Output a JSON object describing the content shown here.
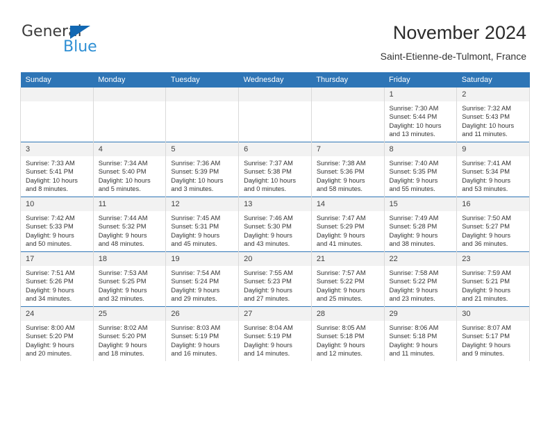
{
  "brand": {
    "line1": "General",
    "line2": "Blue",
    "accent_color": "#1268b3",
    "secondary_color": "#2e8fd4"
  },
  "header": {
    "title": "November 2024",
    "subtitle": "Saint-Etienne-de-Tulmont, France"
  },
  "theme": {
    "header_bg": "#2e75b6",
    "daynum_bg": "#f2f2f2",
    "cell_border": "#d9d9d9"
  },
  "weekday_headers": [
    "Sunday",
    "Monday",
    "Tuesday",
    "Wednesday",
    "Thursday",
    "Friday",
    "Saturday"
  ],
  "weeks": [
    [
      {
        "day": "",
        "lines": []
      },
      {
        "day": "",
        "lines": []
      },
      {
        "day": "",
        "lines": []
      },
      {
        "day": "",
        "lines": []
      },
      {
        "day": "",
        "lines": []
      },
      {
        "day": "1",
        "lines": [
          "Sunrise: 7:30 AM",
          "Sunset: 5:44 PM",
          "Daylight: 10 hours",
          "and 13 minutes."
        ]
      },
      {
        "day": "2",
        "lines": [
          "Sunrise: 7:32 AM",
          "Sunset: 5:43 PM",
          "Daylight: 10 hours",
          "and 11 minutes."
        ]
      }
    ],
    [
      {
        "day": "3",
        "lines": [
          "Sunrise: 7:33 AM",
          "Sunset: 5:41 PM",
          "Daylight: 10 hours",
          "and 8 minutes."
        ]
      },
      {
        "day": "4",
        "lines": [
          "Sunrise: 7:34 AM",
          "Sunset: 5:40 PM",
          "Daylight: 10 hours",
          "and 5 minutes."
        ]
      },
      {
        "day": "5",
        "lines": [
          "Sunrise: 7:36 AM",
          "Sunset: 5:39 PM",
          "Daylight: 10 hours",
          "and 3 minutes."
        ]
      },
      {
        "day": "6",
        "lines": [
          "Sunrise: 7:37 AM",
          "Sunset: 5:38 PM",
          "Daylight: 10 hours",
          "and 0 minutes."
        ]
      },
      {
        "day": "7",
        "lines": [
          "Sunrise: 7:38 AM",
          "Sunset: 5:36 PM",
          "Daylight: 9 hours",
          "and 58 minutes."
        ]
      },
      {
        "day": "8",
        "lines": [
          "Sunrise: 7:40 AM",
          "Sunset: 5:35 PM",
          "Daylight: 9 hours",
          "and 55 minutes."
        ]
      },
      {
        "day": "9",
        "lines": [
          "Sunrise: 7:41 AM",
          "Sunset: 5:34 PM",
          "Daylight: 9 hours",
          "and 53 minutes."
        ]
      }
    ],
    [
      {
        "day": "10",
        "lines": [
          "Sunrise: 7:42 AM",
          "Sunset: 5:33 PM",
          "Daylight: 9 hours",
          "and 50 minutes."
        ]
      },
      {
        "day": "11",
        "lines": [
          "Sunrise: 7:44 AM",
          "Sunset: 5:32 PM",
          "Daylight: 9 hours",
          "and 48 minutes."
        ]
      },
      {
        "day": "12",
        "lines": [
          "Sunrise: 7:45 AM",
          "Sunset: 5:31 PM",
          "Daylight: 9 hours",
          "and 45 minutes."
        ]
      },
      {
        "day": "13",
        "lines": [
          "Sunrise: 7:46 AM",
          "Sunset: 5:30 PM",
          "Daylight: 9 hours",
          "and 43 minutes."
        ]
      },
      {
        "day": "14",
        "lines": [
          "Sunrise: 7:47 AM",
          "Sunset: 5:29 PM",
          "Daylight: 9 hours",
          "and 41 minutes."
        ]
      },
      {
        "day": "15",
        "lines": [
          "Sunrise: 7:49 AM",
          "Sunset: 5:28 PM",
          "Daylight: 9 hours",
          "and 38 minutes."
        ]
      },
      {
        "day": "16",
        "lines": [
          "Sunrise: 7:50 AM",
          "Sunset: 5:27 PM",
          "Daylight: 9 hours",
          "and 36 minutes."
        ]
      }
    ],
    [
      {
        "day": "17",
        "lines": [
          "Sunrise: 7:51 AM",
          "Sunset: 5:26 PM",
          "Daylight: 9 hours",
          "and 34 minutes."
        ]
      },
      {
        "day": "18",
        "lines": [
          "Sunrise: 7:53 AM",
          "Sunset: 5:25 PM",
          "Daylight: 9 hours",
          "and 32 minutes."
        ]
      },
      {
        "day": "19",
        "lines": [
          "Sunrise: 7:54 AM",
          "Sunset: 5:24 PM",
          "Daylight: 9 hours",
          "and 29 minutes."
        ]
      },
      {
        "day": "20",
        "lines": [
          "Sunrise: 7:55 AM",
          "Sunset: 5:23 PM",
          "Daylight: 9 hours",
          "and 27 minutes."
        ]
      },
      {
        "day": "21",
        "lines": [
          "Sunrise: 7:57 AM",
          "Sunset: 5:22 PM",
          "Daylight: 9 hours",
          "and 25 minutes."
        ]
      },
      {
        "day": "22",
        "lines": [
          "Sunrise: 7:58 AM",
          "Sunset: 5:22 PM",
          "Daylight: 9 hours",
          "and 23 minutes."
        ]
      },
      {
        "day": "23",
        "lines": [
          "Sunrise: 7:59 AM",
          "Sunset: 5:21 PM",
          "Daylight: 9 hours",
          "and 21 minutes."
        ]
      }
    ],
    [
      {
        "day": "24",
        "lines": [
          "Sunrise: 8:00 AM",
          "Sunset: 5:20 PM",
          "Daylight: 9 hours",
          "and 20 minutes."
        ]
      },
      {
        "day": "25",
        "lines": [
          "Sunrise: 8:02 AM",
          "Sunset: 5:20 PM",
          "Daylight: 9 hours",
          "and 18 minutes."
        ]
      },
      {
        "day": "26",
        "lines": [
          "Sunrise: 8:03 AM",
          "Sunset: 5:19 PM",
          "Daylight: 9 hours",
          "and 16 minutes."
        ]
      },
      {
        "day": "27",
        "lines": [
          "Sunrise: 8:04 AM",
          "Sunset: 5:19 PM",
          "Daylight: 9 hours",
          "and 14 minutes."
        ]
      },
      {
        "day": "28",
        "lines": [
          "Sunrise: 8:05 AM",
          "Sunset: 5:18 PM",
          "Daylight: 9 hours",
          "and 12 minutes."
        ]
      },
      {
        "day": "29",
        "lines": [
          "Sunrise: 8:06 AM",
          "Sunset: 5:18 PM",
          "Daylight: 9 hours",
          "and 11 minutes."
        ]
      },
      {
        "day": "30",
        "lines": [
          "Sunrise: 8:07 AM",
          "Sunset: 5:17 PM",
          "Daylight: 9 hours",
          "and 9 minutes."
        ]
      }
    ]
  ]
}
